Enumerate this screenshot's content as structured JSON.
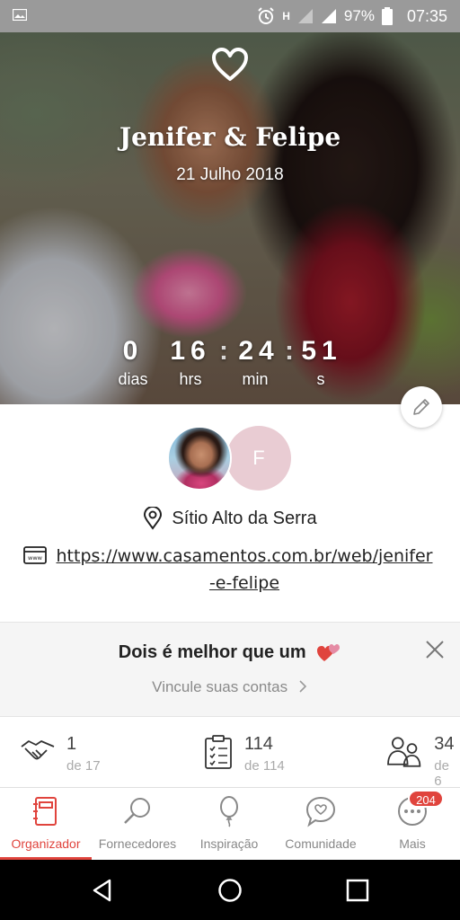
{
  "status_bar": {
    "network": "H",
    "battery": "97%",
    "time": "07:35"
  },
  "hero": {
    "names": "Jenifer & Felipe",
    "date": "21 Julho 2018",
    "countdown": [
      {
        "value": "0",
        "label": "dias"
      },
      {
        "value": "16",
        "label": "hrs"
      },
      {
        "value": "24",
        "label": "min"
      },
      {
        "value": "51",
        "label": "s"
      }
    ]
  },
  "profile": {
    "avatar_letter": "F",
    "venue": "Sítio Alto da Serra",
    "url": "https://www.casamentos.com.br/web/jenifer-e-felipe"
  },
  "promo": {
    "title": "Dois é melhor que um",
    "link": "Vincule suas contas"
  },
  "stats": [
    {
      "value": "1",
      "sub": "de 17",
      "icon": "handshake-icon"
    },
    {
      "value": "114",
      "sub": "de 114",
      "icon": "checklist-icon"
    },
    {
      "value": "34",
      "sub": "de 6",
      "icon": "guests-icon"
    }
  ],
  "bottom_nav": {
    "items": [
      {
        "label": "Organizador",
        "icon": "planner-icon",
        "active": true
      },
      {
        "label": "Fornecedores",
        "icon": "search-icon"
      },
      {
        "label": "Inspiração",
        "icon": "balloon-icon"
      },
      {
        "label": "Comunidade",
        "icon": "chat-heart-icon"
      },
      {
        "label": "Mais",
        "icon": "more-icon"
      }
    ],
    "badge": "204"
  },
  "colors": {
    "accent": "#e0443d",
    "avatar_placeholder": "#e9ccd3",
    "status_bar": "#9a9a9a"
  }
}
